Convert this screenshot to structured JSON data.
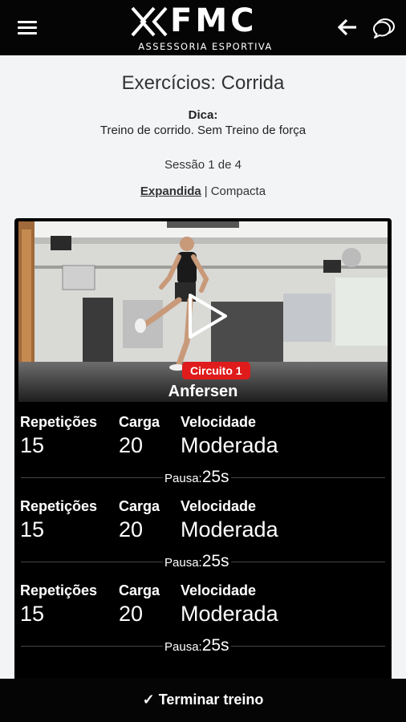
{
  "header": {
    "logo_text": "FMC",
    "logo_subtitle": "ASSESSORIA ESPORTIVA",
    "menu_icon": "hamburger-menu-icon",
    "back_icon": "arrow-left-icon",
    "chat_icon": "chat-bubble-icon",
    "background": "#050505"
  },
  "page": {
    "title": "Exercícios: Corrida",
    "tip_label": "Dica:",
    "tip_text": "Treino de corrido. Sem Treino de força",
    "session": "Sessão 1 de 4",
    "view_expanded": "Expandida",
    "view_separator": "|",
    "view_compact": "Compacta"
  },
  "exercise": {
    "circuit_badge": "Circuito 1",
    "name": "Anfersen",
    "badge_color": "#e01b1b",
    "video_icon": "play-icon",
    "sets": [
      {
        "reps_label": "Repetições",
        "reps": "15",
        "load_label": "Carga",
        "load": "20",
        "speed_label": "Velocidade",
        "speed": "Moderada",
        "pause_label": "Pausa:",
        "pause": "25s"
      },
      {
        "reps_label": "Repetições",
        "reps": "15",
        "load_label": "Carga",
        "load": "20",
        "speed_label": "Velocidade",
        "speed": "Moderada",
        "pause_label": "Pausa:",
        "pause": "25s"
      },
      {
        "reps_label": "Repetições",
        "reps": "15",
        "load_label": "Carga",
        "load": "20",
        "speed_label": "Velocidade",
        "speed": "Moderada",
        "pause_label": "Pausa:",
        "pause": "25s"
      }
    ]
  },
  "footer": {
    "finish_label": "✓ Terminar treino"
  }
}
